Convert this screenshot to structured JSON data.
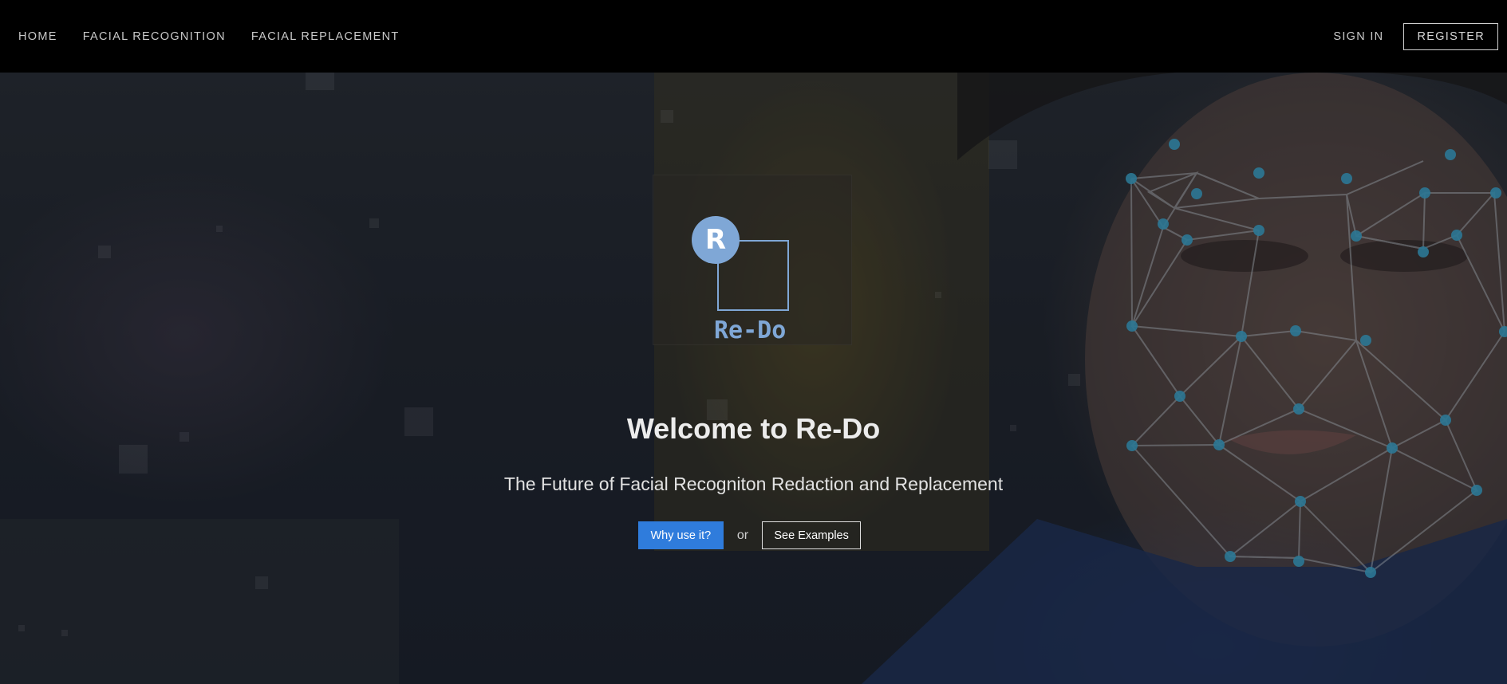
{
  "nav": {
    "left": [
      "HOME",
      "FACIAL RECOGNITION",
      "FACIAL REPLACEMENT"
    ],
    "sign_in": "SIGN IN",
    "register": "REGISTER"
  },
  "logo": {
    "badge_letter": "R",
    "name": "Re-Do"
  },
  "hero": {
    "title": "Welcome to Re-Do",
    "subtitle": "The Future of Facial Recogniton Redaction and Replacement",
    "primary_button": "Why use it?",
    "separator": "or",
    "secondary_button": "See Examples"
  },
  "colors": {
    "accent_blue": "#2f7cdc",
    "logo_blue": "#7fa7d6",
    "navbar_bg": "#000000",
    "mesh_node": "#3fb0d8"
  }
}
